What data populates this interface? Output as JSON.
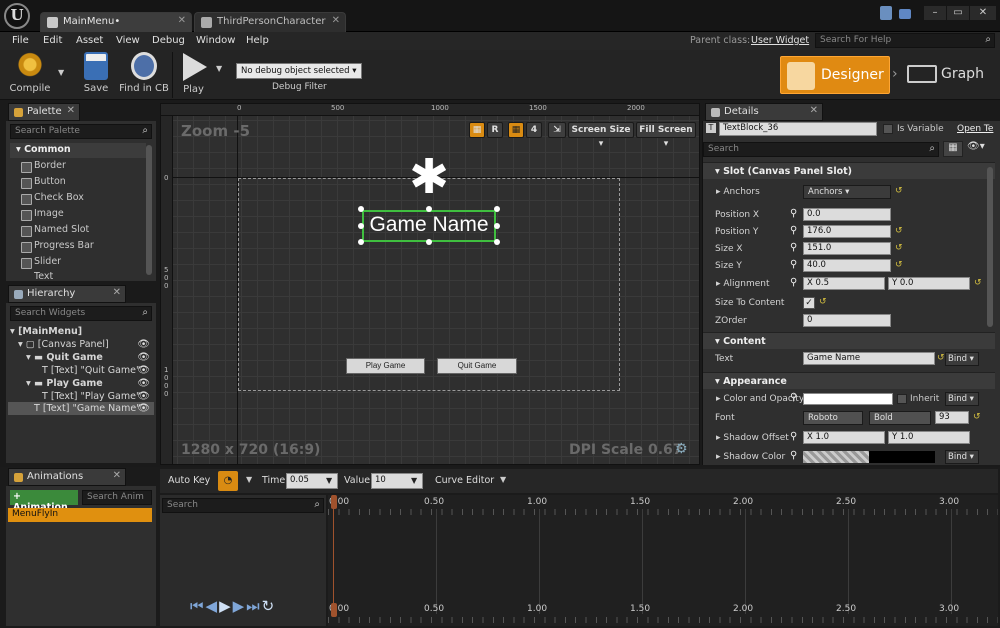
{
  "tabs": [
    {
      "label": "MainMenu•"
    },
    {
      "label": "ThirdPersonCharacter"
    }
  ],
  "menu": [
    "File",
    "Edit",
    "Asset",
    "View",
    "Debug",
    "Window",
    "Help"
  ],
  "parent_class_label": "Parent class:",
  "parent_class_value": "User Widget",
  "help_search_placeholder": "Search For Help",
  "toolbar": {
    "compile": "Compile",
    "save": "Save",
    "find_in_cb": "Find in CB",
    "play": "Play",
    "debug_select": "No debug object selected ▾",
    "debug_filter": "Debug Filter"
  },
  "modes": {
    "designer": "Designer",
    "graph": "Graph"
  },
  "palette": {
    "title": "Palette",
    "search": "Search Palette",
    "category": "Common",
    "items": [
      "Border",
      "Button",
      "Check Box",
      "Image",
      "Named Slot",
      "Progress Bar",
      "Slider",
      "Text"
    ]
  },
  "hierarchy": {
    "title": "Hierarchy",
    "search": "Search Widgets",
    "items": [
      "[MainMenu]",
      "[Canvas Panel]",
      "Quit Game",
      "[Text] \"Quit Game\"",
      "Play Game",
      "[Text] \"Play Game\"",
      "[Text] \"Game Name\""
    ]
  },
  "viewport": {
    "zoom": "Zoom -5",
    "ruler_top": [
      "0",
      "500",
      "1000",
      "1500",
      "2000"
    ],
    "ruler_left": [
      "0",
      "500",
      "1000"
    ],
    "btn_r": "R",
    "btn_4": "4",
    "screen_size": "Screen Size ▾",
    "fill_screen": "Fill Screen ▾",
    "game_name": "Game Name",
    "play_game": "Play Game",
    "quit_game": "Quit Game",
    "resolution": "1280 x 720 (16:9)",
    "dpi": "DPI Scale 0.67"
  },
  "details": {
    "title": "Details",
    "widget_name": "TextBlock_36",
    "is_variable": "Is Variable",
    "open": "Open Te",
    "search": "Search",
    "slot_header": "Slot (Canvas Panel Slot)",
    "anchors_label": "Anchors",
    "anchors_value": "Anchors ▾",
    "pos_x_label": "Position X",
    "pos_x": "0.0",
    "pos_y_label": "Position Y",
    "pos_y": "176.0",
    "size_x_label": "Size X",
    "size_x": "151.0",
    "size_y_label": "Size Y",
    "size_y": "40.0",
    "alignment_label": "Alignment",
    "align_x": "X  0.5",
    "align_y": "Y  0.0",
    "size_to_content_label": "Size To Content",
    "zorder_label": "ZOrder",
    "zorder": "0",
    "content_header": "Content",
    "text_label": "Text",
    "text_value": "Game Name",
    "bind": "Bind ▾",
    "appearance_header": "Appearance",
    "color_label": "Color and Opacity",
    "inherit": "Inherit",
    "font_label": "Font",
    "font_family": "Roboto",
    "font_style": "Bold",
    "font_size": "93",
    "shadow_offset_label": "Shadow Offset",
    "shadow_x": "X  1.0",
    "shadow_y": "Y  1.0",
    "shadow_color_label": "Shadow Color"
  },
  "animations": {
    "title": "Animations",
    "add": "+ Animation",
    "search": "Search Anim",
    "items": [
      "MenuFlyIn"
    ]
  },
  "timeline": {
    "auto_key": "Auto Key",
    "time_label": "Time",
    "time_value": "0.05",
    "value_label": "Value",
    "value_value": "10",
    "curve_editor": "Curve Editor",
    "search": "Search",
    "ticks": [
      "0.00",
      "0.50",
      "1.00",
      "1.50",
      "2.00",
      "2.50",
      "3.00"
    ]
  },
  "colors": {
    "accent": "#e0900f",
    "selection_green": "#3fbf3f"
  }
}
